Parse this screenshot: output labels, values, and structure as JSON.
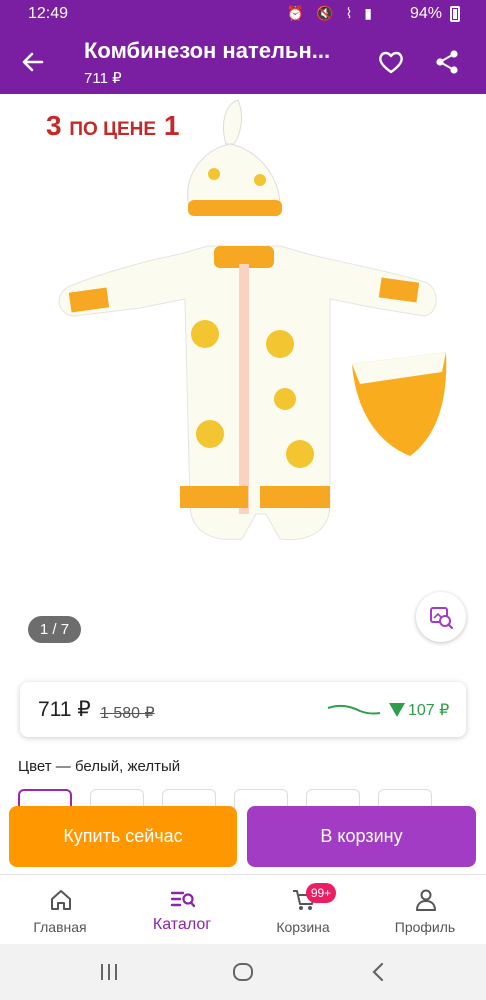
{
  "status_bar": {
    "time": "12:49",
    "battery": "94%"
  },
  "header": {
    "title": "Комбинезон нательн...",
    "subtitle": "711 ₽"
  },
  "gallery": {
    "promo_big": "3",
    "promo_text": "ПО ЦЕНЕ",
    "promo_big2": "1",
    "counter": "1 / 7"
  },
  "price_card": {
    "price": "711 ₽",
    "old_price": "1 580 ₽",
    "drop_value": "107 ₽"
  },
  "color": {
    "label": "Цвет — белый, желтый"
  },
  "buttons": {
    "buy_now": "Купить сейчас",
    "to_cart": "В корзину"
  },
  "bottom_nav": {
    "items": [
      {
        "label": "Главная",
        "icon": "home-icon"
      },
      {
        "label": "Каталог",
        "icon": "catalog-search-icon"
      },
      {
        "label": "Корзина",
        "icon": "cart-icon",
        "badge": "99+"
      },
      {
        "label": "Профиль",
        "icon": "profile-icon"
      }
    ]
  },
  "colors": {
    "brand": "#7b1fa2",
    "buy_now": "#ff9800",
    "to_cart": "#a33cc4",
    "accent_green": "#2e9e4b"
  }
}
